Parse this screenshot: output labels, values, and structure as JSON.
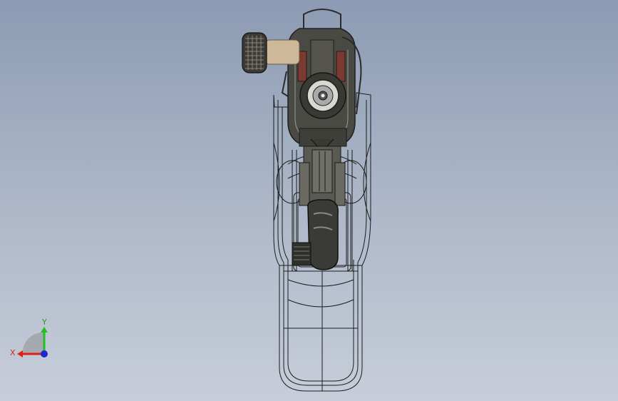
{
  "viewport": {
    "background_top": "#8c9bb3",
    "background_bottom": "#c7ced9"
  },
  "model": {
    "part_color": "#4a4a44",
    "accent_color": "#7a3a30",
    "knob_color": "#cdb99a",
    "wire_color": "#2b2b2b"
  },
  "triad": {
    "x_label": "X",
    "y_label": "Y",
    "x_color": "#e0201c",
    "y_color": "#22c022",
    "z_color": "#1a2ad0"
  }
}
